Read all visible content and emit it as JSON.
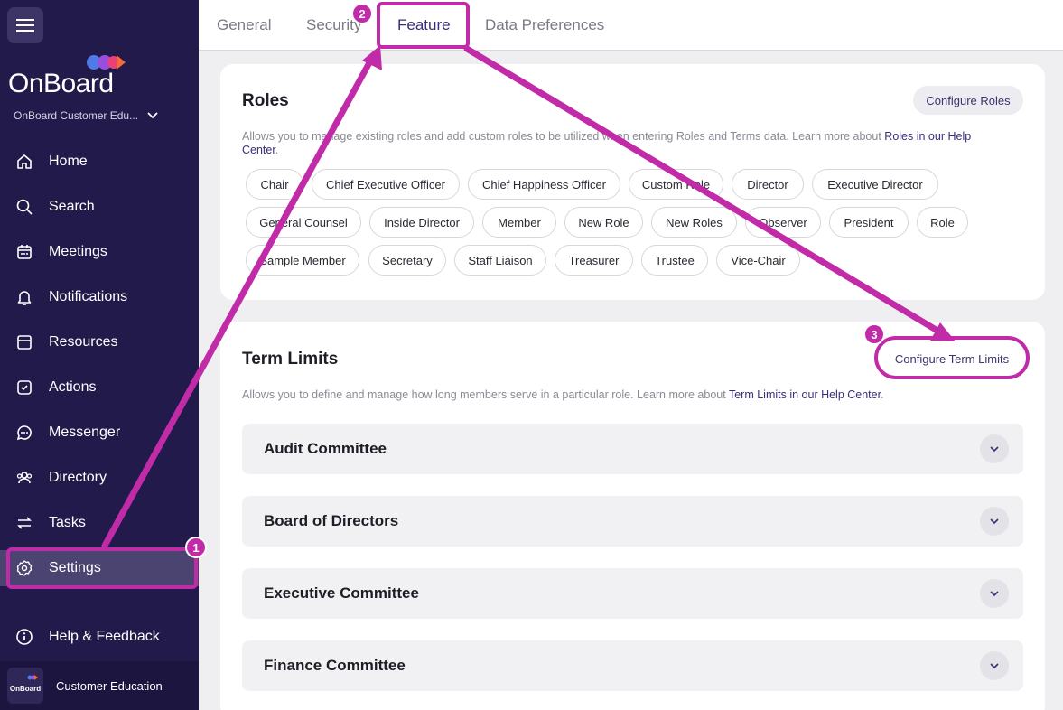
{
  "sidebar": {
    "logo": "OnBoard",
    "org_name": "OnBoard Customer Edu...",
    "items": [
      {
        "label": "Home"
      },
      {
        "label": "Search"
      },
      {
        "label": "Meetings"
      },
      {
        "label": "Notifications"
      },
      {
        "label": "Resources"
      },
      {
        "label": "Actions"
      },
      {
        "label": "Messenger"
      },
      {
        "label": "Directory"
      },
      {
        "label": "Tasks"
      },
      {
        "label": "Settings"
      }
    ],
    "help_label": "Help & Feedback",
    "footer_logo": "OnBoard",
    "footer_name": "Customer Education"
  },
  "tabs": [
    {
      "label": "General"
    },
    {
      "label": "Security"
    },
    {
      "label": "Feature"
    },
    {
      "label": "Data Preferences"
    }
  ],
  "roles": {
    "title": "Roles",
    "configure_label": "Configure Roles",
    "desc": "Allows you to manage existing roles and add custom roles to be utilized when entering Roles and Terms data. Learn more about ",
    "desc_link": "Roles in our Help Center",
    "desc_end": ".",
    "chips": [
      "Chair",
      "Chief Executive Officer",
      "Chief Happiness Officer",
      "Custom Role",
      "Director",
      "Executive Director",
      "General Counsel",
      "Inside Director",
      "Member",
      "New Role",
      "New Roles",
      "Observer",
      "President",
      "Role",
      "Sample Member",
      "Secretary",
      "Staff Liaison",
      "Treasurer",
      "Trustee",
      "Vice-Chair"
    ]
  },
  "term_limits": {
    "title": "Term Limits",
    "configure_label": "Configure Term Limits",
    "desc": "Allows you to define and manage how long members serve in a particular role. Learn more about ",
    "desc_link": "Term Limits in our Help Center",
    "desc_end": ".",
    "committees": [
      "Audit Committee",
      "Board of Directors",
      "Executive Committee",
      "Finance Committee"
    ]
  },
  "annotations": [
    "1",
    "2",
    "3"
  ],
  "colors": {
    "sidebar": "#221a4a",
    "accent": "#3b2d7a",
    "highlight": "#c22ba8"
  }
}
